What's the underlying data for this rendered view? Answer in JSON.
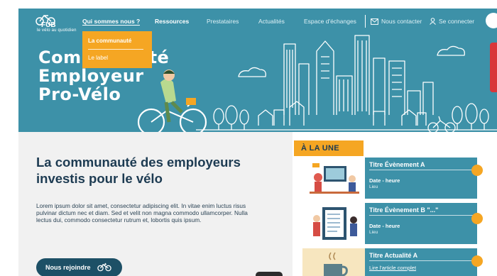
{
  "brand": {
    "logo_name": "FUB",
    "tagline": "le vélo au quotidien"
  },
  "nav": {
    "items": [
      "Qui sommes nous ?",
      "Ressources",
      "Prestataires",
      "Actualités",
      "Espace d'échanges"
    ],
    "contact": "Nous contacter",
    "login": "Se connecter"
  },
  "dropdown": {
    "items": [
      "La communauté",
      "Le label"
    ]
  },
  "hero": {
    "line1": "Communauté",
    "line2": "Employeur",
    "line3": "Pro-Vélo"
  },
  "intro": {
    "title": "La communauté des employeurs investis pour le vélo",
    "body": "Lorem ipsum dolor sit amet, consectetur adipiscing elit. In vitae enim luctus risus pulvinar dictum nec et diam. Sed et velit non magna commodo ullamcorper. Nulla lectus dui, commodo consectetur rutrum et, lobortis quis ipsum.",
    "cta": "Nous rejoindre"
  },
  "une": {
    "label": "À LA UNE",
    "cards": [
      {
        "title": "Titre Évènement A",
        "date": "Date - heure",
        "place": "Lieu"
      },
      {
        "title": "Titre Évènement B \"...\"",
        "date": "Date - heure",
        "place": "Lieu"
      },
      {
        "title": "Titre Actualité A",
        "link": "Lire l'article complet"
      }
    ]
  },
  "colors": {
    "primary": "#3d91a8",
    "accent": "#f5a623",
    "dark": "#1d3b52"
  }
}
